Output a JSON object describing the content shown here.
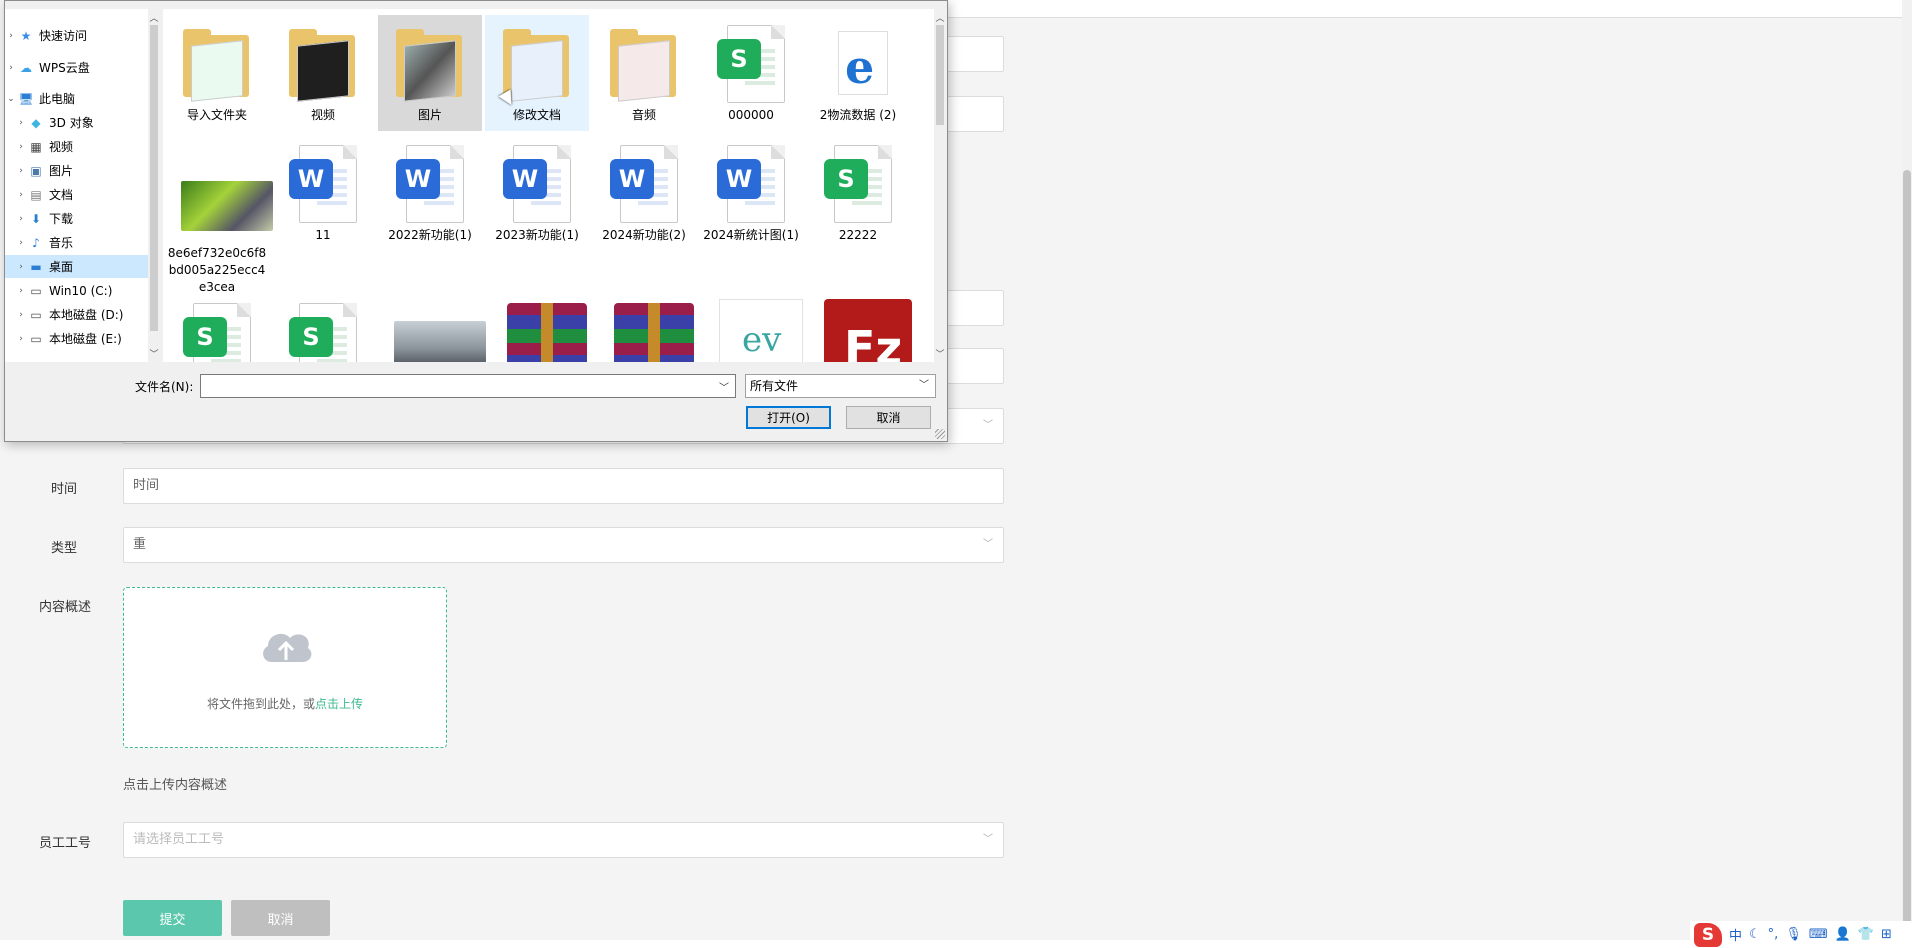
{
  "form": {
    "time_label": "时间",
    "time_value": "时间",
    "type_label": "类型",
    "type_value": "重",
    "content_label": "内容概述",
    "upload_text": "将文件拖到此处，或",
    "upload_link": "点击上传",
    "upload_hint": "点击上传内容概述",
    "employee_label": "员工工号",
    "employee_placeholder": "请选择员工工号",
    "submit_label": "提交",
    "cancel_label": "取消"
  },
  "tray": {
    "ime_logo": "S",
    "ime_lang": "中"
  },
  "dialog": {
    "nav": [
      {
        "label": "快速访问",
        "icon": "star-icon"
      },
      {
        "label": "WPS云盘",
        "icon": "cloud-icon"
      },
      {
        "label": "此电脑",
        "icon": "computer-icon"
      },
      {
        "label": "3D 对象",
        "icon": "cube-icon"
      },
      {
        "label": "视频",
        "icon": "film-icon"
      },
      {
        "label": "图片",
        "icon": "image-icon"
      },
      {
        "label": "文档",
        "icon": "document-icon"
      },
      {
        "label": "下载",
        "icon": "download-icon"
      },
      {
        "label": "音乐",
        "icon": "music-icon"
      },
      {
        "label": "桌面",
        "icon": "desktop-icon"
      },
      {
        "label": "Win10 (C:)",
        "icon": "drive-icon"
      },
      {
        "label": "本地磁盘 (D:)",
        "icon": "drive-icon"
      },
      {
        "label": "本地磁盘 (E:)",
        "icon": "drive-icon"
      }
    ],
    "files": [
      {
        "name": "导入文件夹"
      },
      {
        "name": "视频"
      },
      {
        "name": "图片"
      },
      {
        "name": "修改文档"
      },
      {
        "name": "音频"
      },
      {
        "name": "000000"
      },
      {
        "name": "2物流数据 (2)"
      },
      {
        "name": "8e6ef732e0c6f8bd005a225ecc4e3cea"
      },
      {
        "name": "11"
      },
      {
        "name": "2022新功能(1)"
      },
      {
        "name": "2023新功能(1)"
      },
      {
        "name": "2024新功能(2)"
      },
      {
        "name": "2024新统计图(1)"
      },
      {
        "name": "22222"
      }
    ],
    "filename_label": "文件名(N):",
    "filename_value": "",
    "filetype": "所有文件",
    "open_label": "打开(O)",
    "cancel_label": "取消",
    "badge_s": "S",
    "badge_w": "W",
    "edge_letter": "e",
    "fz_letters": "Fz",
    "swirl": "ev"
  }
}
